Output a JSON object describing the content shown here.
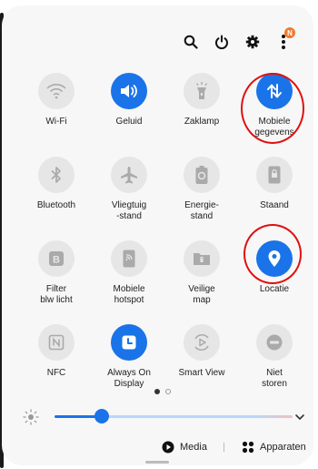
{
  "header": {
    "badge": "N"
  },
  "tiles": [
    {
      "id": "wifi",
      "label": "Wi-Fi",
      "on": false,
      "icon": "wifi-icon"
    },
    {
      "id": "sound",
      "label": "Geluid",
      "on": true,
      "icon": "speaker-icon"
    },
    {
      "id": "flashlight",
      "label": "Zaklamp",
      "on": false,
      "icon": "flashlight-icon"
    },
    {
      "id": "mobile-data",
      "label": "Mobiele\ngegevens",
      "on": true,
      "icon": "data-arrows-icon"
    },
    {
      "id": "bluetooth",
      "label": "Bluetooth",
      "on": false,
      "icon": "bluetooth-icon"
    },
    {
      "id": "airplane",
      "label": "Vliegtuig\n-stand",
      "on": false,
      "icon": "airplane-icon"
    },
    {
      "id": "power-saving",
      "label": "Energie-\nstand",
      "on": false,
      "icon": "battery-recycle-icon"
    },
    {
      "id": "standing",
      "label": "Staand",
      "on": false,
      "icon": "portrait-lock-icon"
    },
    {
      "id": "blue-light",
      "label": "Filter\nblw licht",
      "on": false,
      "icon": "blue-light-filter-icon"
    },
    {
      "id": "hotspot",
      "label": "Mobiele\nhotspot",
      "on": false,
      "icon": "hotspot-icon"
    },
    {
      "id": "secure-folder",
      "label": "Veilige\nmap",
      "on": false,
      "icon": "secure-folder-icon"
    },
    {
      "id": "location",
      "label": "Locatie",
      "on": true,
      "icon": "location-pin-icon"
    },
    {
      "id": "nfc",
      "label": "NFC",
      "on": false,
      "icon": "nfc-icon"
    },
    {
      "id": "aod",
      "label": "Always On\nDisplay",
      "on": true,
      "icon": "clock-display-icon"
    },
    {
      "id": "smart-view",
      "label": "Smart View",
      "on": false,
      "icon": "cast-icon"
    },
    {
      "id": "dnd",
      "label": "Niet\nstoren",
      "on": false,
      "icon": "minus-circle-icon"
    }
  ],
  "pager": {
    "total": 2,
    "current": 1
  },
  "brightness": {
    "level_fraction": 0.2
  },
  "bottom": {
    "media_label": "Media",
    "devices_label": "Apparaten"
  },
  "colors": {
    "accent": "#1a73e8",
    "highlight_ring": "#e01010",
    "badge": "#f07a2e"
  }
}
